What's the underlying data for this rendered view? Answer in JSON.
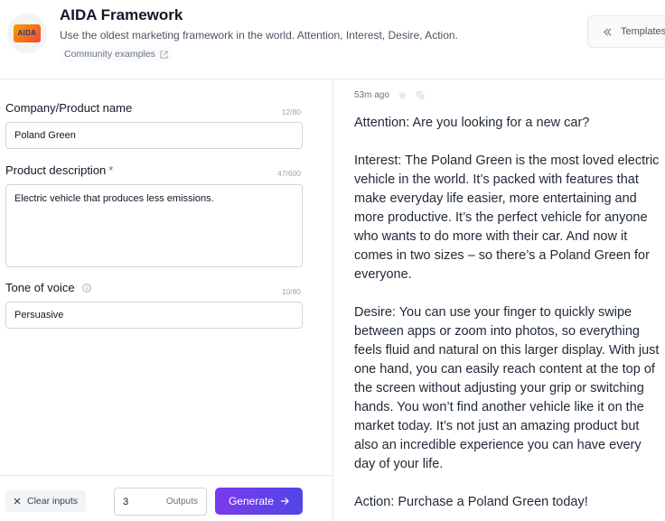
{
  "header": {
    "logo_text": "AIDA",
    "title": "AIDA Framework",
    "subtitle": "Use the oldest marketing framework in the world. Attention, Interest, Desire, Action.",
    "community_link": "Community examples",
    "templates_label": "Templates"
  },
  "form": {
    "company": {
      "label": "Company/Product name",
      "counter": "12/80",
      "value": "Poland Green"
    },
    "description": {
      "label": "Product description",
      "required_mark": "*",
      "counter": "47/600",
      "value": "Electric vehicle that produces less emissions."
    },
    "tone": {
      "label": "Tone of voice",
      "counter": "10/80",
      "value": "Persuasive"
    }
  },
  "footer": {
    "clear_label": "Clear inputs",
    "outputs_count": "3",
    "outputs_label": "Outputs",
    "generate_label": "Generate"
  },
  "output": {
    "timestamp": "53m ago",
    "paragraphs": [
      "Attention: Are you looking for a new car?",
      "Interest: The Poland Green is the most loved electric vehicle in the world. It’s packed with features that make everyday life easier, more entertaining and more productive. It’s the perfect vehicle for anyone who wants to do more with their car. And now it comes in two sizes – so there’s a Poland Green for everyone.",
      "Desire: You can use your finger to quickly swipe between apps or zoom into photos, so everything feels fluid and natural on this larger display. With just one hand, you can easily reach content at the top of the screen without adjusting your grip or switching hands. You won’t find another vehicle like it on the market today. It’s not just an amazing product but also an incredible experience you can have every day of your life.",
      "Action: Purchase a Poland Green today!"
    ]
  },
  "colors": {
    "accent_start": "#7c3aed",
    "accent_end": "#4f46e5",
    "border": "#e5e7eb"
  }
}
